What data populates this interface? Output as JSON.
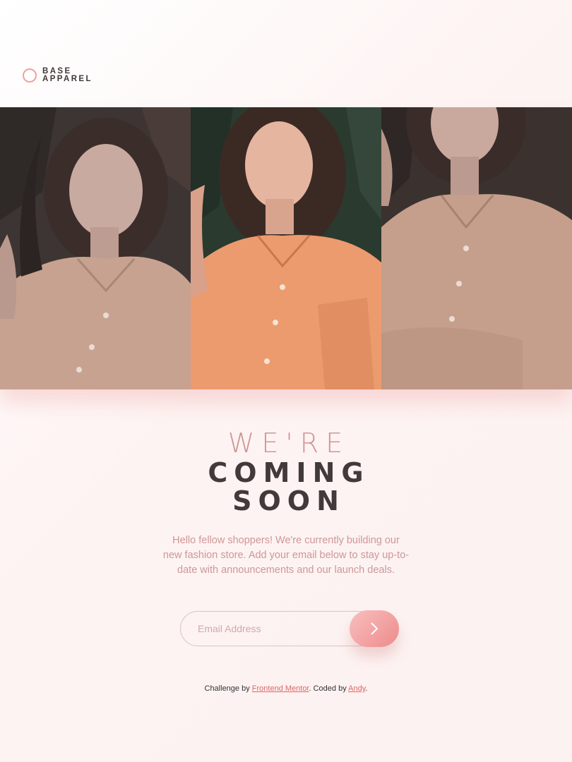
{
  "logo": {
    "line1": "BASE",
    "line2": "APPAREL"
  },
  "hero": {
    "panels": [
      {
        "name": "hero-photo-left"
      },
      {
        "name": "hero-photo-center"
      },
      {
        "name": "hero-photo-right"
      }
    ]
  },
  "headline": {
    "light": "WE'RE",
    "line2": "COMING",
    "line3": "SOON"
  },
  "description": "Hello fellow shoppers! We're currently building our new fashion store. Add your email below to stay up-to-date with announcements and our launch deals.",
  "form": {
    "email_placeholder": "Email Address"
  },
  "footer": {
    "prefix": "Challenge by ",
    "link1": "Frontend Mentor",
    "middle": ". Coded by ",
    "link2": "Andy",
    "suffix": "."
  },
  "colors": {
    "accent": "#ce9797",
    "dark": "#423a3a",
    "button_start": "#f8bfbf",
    "button_end": "#ee8b8b",
    "link": "#e26464"
  }
}
